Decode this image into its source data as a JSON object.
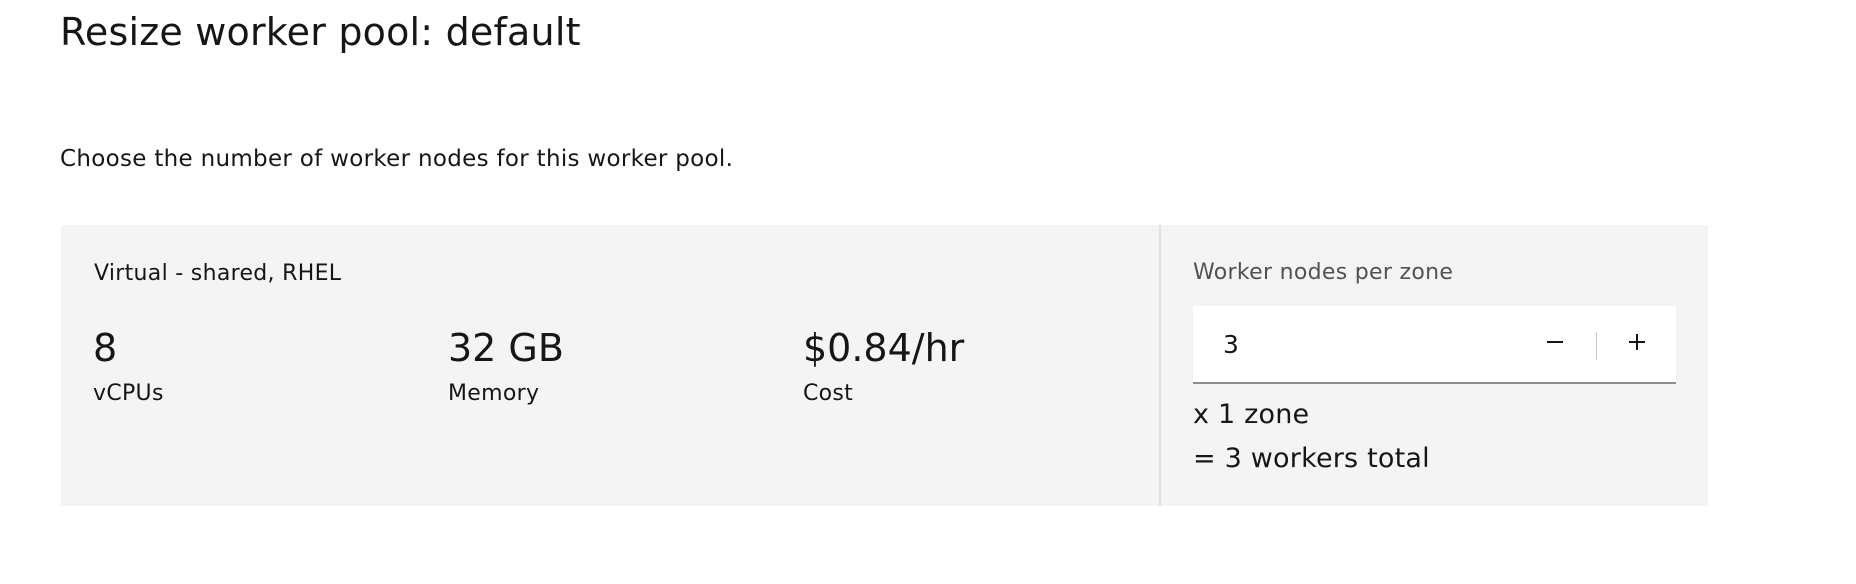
{
  "page": {
    "title": "Resize worker pool: default",
    "description": "Choose the number of worker nodes for this worker pool."
  },
  "flavor": {
    "name": "Virtual - shared, RHEL",
    "stats": [
      {
        "value": "8",
        "label": "vCPUs"
      },
      {
        "value": "32 GB",
        "label": "Memory"
      },
      {
        "value": "$0.84/hr",
        "label": "Cost"
      }
    ]
  },
  "workers": {
    "label": "Worker nodes per zone",
    "value": "3",
    "decrement_icon": "minus-icon",
    "increment_icon": "plus-icon",
    "zones_text": "x 1 zone",
    "total_text": "= 3 workers total"
  }
}
